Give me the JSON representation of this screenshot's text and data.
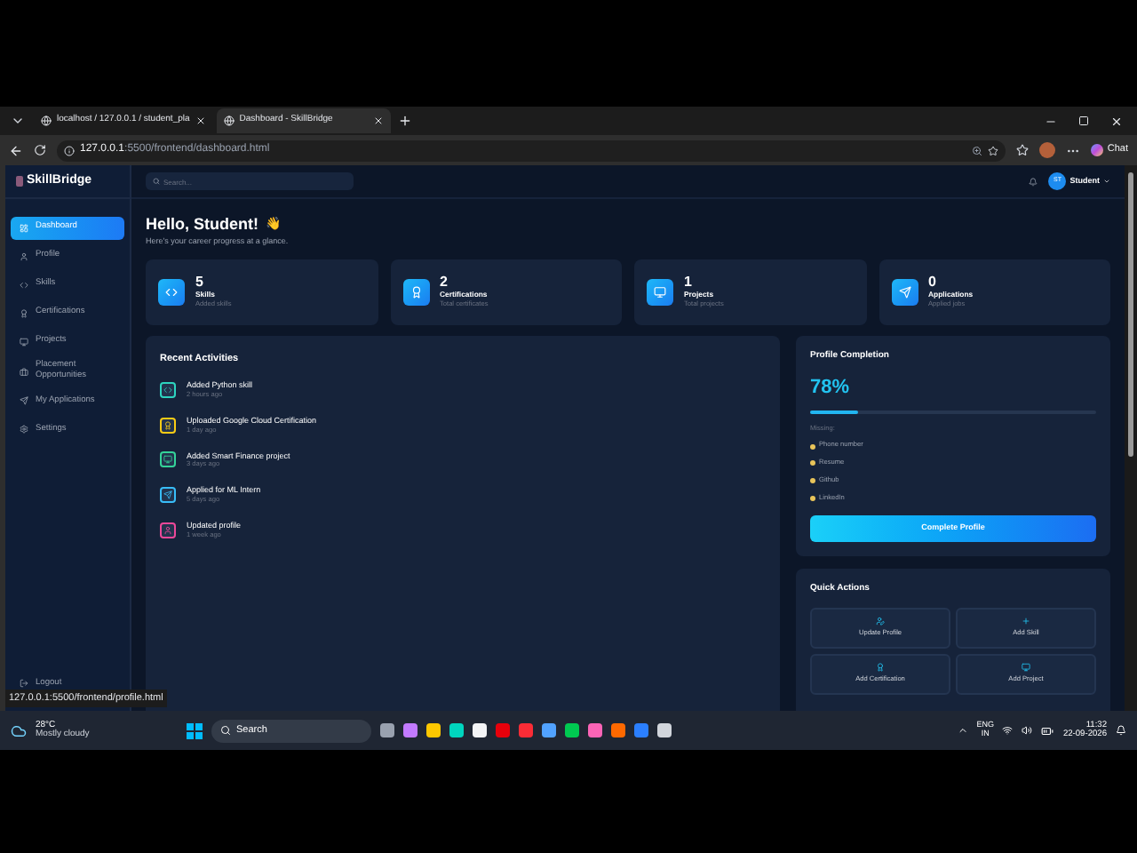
{
  "browser": {
    "tabs": [
      {
        "label": "localhost / 127.0.0.1 / student_pla",
        "selected": false
      },
      {
        "label": "Dashboard - SkillBridge",
        "selected": true
      }
    ],
    "url_host": "127.0.0.1",
    "url_path": ":5500/frontend/dashboard.html",
    "chat": "Chat"
  },
  "sidebar": {
    "brand": "SkillBridge",
    "items": [
      {
        "label": "Dashboard",
        "selected": true
      },
      {
        "label": "Profile",
        "selected": false
      },
      {
        "label": "Skills",
        "selected": false
      },
      {
        "label": "Certifications",
        "selected": false
      },
      {
        "label": "Projects",
        "selected": false
      },
      {
        "label": "Placement Opportunities",
        "selected": false
      },
      {
        "label": "My Applications",
        "selected": false
      },
      {
        "label": "Settings",
        "selected": false
      }
    ],
    "logout": "Logout"
  },
  "header": {
    "search": {
      "placeholder": "Search..."
    },
    "avatar": "ST",
    "user": "Student"
  },
  "greeting": {
    "title": "Hello, Student!",
    "emoji": "👋",
    "subtitle": "Here's your career progress at a glance."
  },
  "stats": [
    {
      "value": "5",
      "label": "Skills",
      "sub": "Added skills"
    },
    {
      "value": "2",
      "label": "Certifications",
      "sub": "Total certificates"
    },
    {
      "value": "1",
      "label": "Projects",
      "sub": "Total projects"
    },
    {
      "value": "0",
      "label": "Applications",
      "sub": "Applied jobs"
    }
  ],
  "activities": {
    "title": "Recent Activities",
    "items": [
      {
        "text": "Added Python skill",
        "time": "2 hours ago",
        "color": "#2dd4bf"
      },
      {
        "text": "Uploaded Google Cloud Certification",
        "time": "1 day ago",
        "color": "#facc15"
      },
      {
        "text": "Added Smart Finance project",
        "time": "3 days ago",
        "color": "#34d399"
      },
      {
        "text": "Applied for ML Intern",
        "time": "5 days ago",
        "color": "#38bdf8"
      },
      {
        "text": "Updated profile",
        "time": "1 week ago",
        "color": "#ec4899"
      }
    ]
  },
  "profile_completion": {
    "title": "Profile Completion",
    "percent": "78%",
    "level": 0.17,
    "missing_label": "Missing:",
    "missing": [
      "Phone number",
      "Resume",
      "Github",
      "LinkedIn"
    ],
    "button": "Complete Profile"
  },
  "quick_actions": {
    "title": "Quick Actions",
    "items": [
      "Update Profile",
      "Add Skill",
      "Add Certification",
      "Add Project"
    ]
  },
  "status_url": "127.0.0.1:5500/frontend/profile.html",
  "taskbar": {
    "temp": "28°C",
    "weather": "Mostly cloudy",
    "search": "Search",
    "lang": "ENG",
    "region": "IN",
    "time": "11:32",
    "date": "22-09-2026"
  }
}
